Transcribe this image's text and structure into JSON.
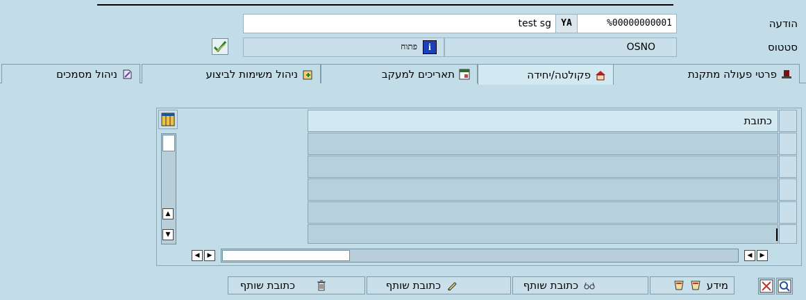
{
  "header": {
    "message_label": "הודעה",
    "message_number": "%00000000001",
    "message_code": "YA",
    "message_text": "test sg",
    "status_label": "סטטוס",
    "status_value": "OSNO",
    "status_text": "פתוח"
  },
  "tabs": [
    {
      "label": "פרטי פעולה מתקנת",
      "icon": "hat-icon"
    },
    {
      "label": "פקולטה/יחידה",
      "icon": "house-icon",
      "active": true
    },
    {
      "label": "תאריכים למעקב",
      "icon": "calendar-icon"
    },
    {
      "label": "ניהול משימות לביצוע",
      "icon": "task-icon"
    },
    {
      "label": "ניהול מסמכים",
      "icon": "document-icon"
    }
  ],
  "table": {
    "column_header": "כתובת",
    "rows": [
      "",
      "",
      "",
      "",
      ""
    ]
  },
  "buttons": {
    "info": "מידע",
    "partner_address_display": "כתובת שותף",
    "partner_address_edit": "כתובת שותף",
    "partner_address_delete": "כתובת שותף"
  }
}
